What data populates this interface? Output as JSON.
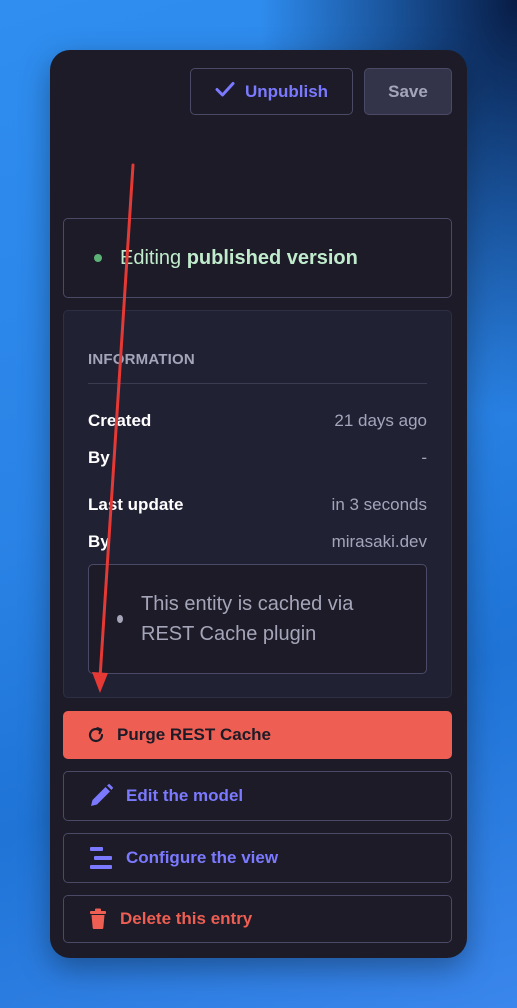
{
  "toolbar": {
    "unpublish_label": "Unpublish",
    "save_label": "Save"
  },
  "status": {
    "prefix": "Editing",
    "state": "published version",
    "dot_color": "#5cb176"
  },
  "information": {
    "heading": "INFORMATION",
    "rows": [
      {
        "label": "Created",
        "value": "21 days ago"
      },
      {
        "label": "By",
        "value": "-"
      },
      {
        "label": "Last update",
        "value": "in 3 seconds"
      },
      {
        "label": "By",
        "value": "mirasaki.dev"
      }
    ],
    "cache_notice": "This entity is cached via REST Cache plugin"
  },
  "actions": {
    "purge_label": "Purge REST Cache",
    "edit_label": "Edit the model",
    "configure_label": "Configure the view",
    "delete_label": "Delete this entry"
  },
  "colors": {
    "accent": "#7b79ff",
    "danger": "#ee5e52",
    "panel": "#1c1b27",
    "annotation_arrow": "#e53935"
  },
  "icons": [
    "check-icon",
    "refresh-icon",
    "pencil-icon",
    "layout-icon",
    "trash-icon"
  ]
}
